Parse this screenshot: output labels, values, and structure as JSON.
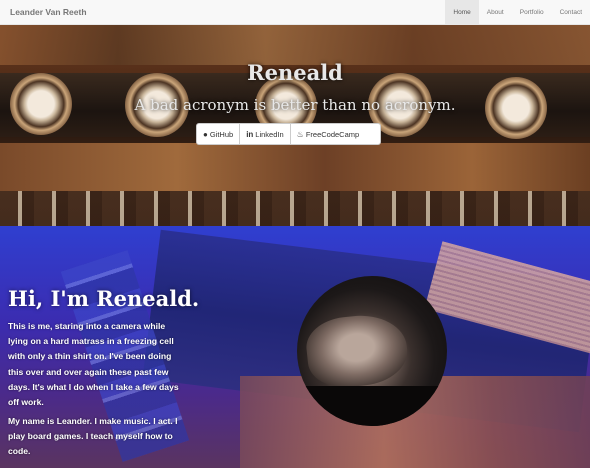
{
  "nav": {
    "brand": "Leander Van Reeth",
    "items": [
      {
        "label": "Home",
        "active": true
      },
      {
        "label": "About",
        "active": false
      },
      {
        "label": "Portfolio",
        "active": false
      },
      {
        "label": "Contact",
        "active": false
      }
    ]
  },
  "hero": {
    "title": "Reneald",
    "subtitle": "A bad acronym is better than no acronym.",
    "buttons": [
      {
        "label": "GitHub",
        "icon": "github-icon"
      },
      {
        "label": "LinkedIn",
        "icon": "linkedin-icon"
      },
      {
        "label": "FreeCodeCamp",
        "icon": "fire-icon"
      }
    ]
  },
  "about": {
    "title": "Hi, I'm Reneald.",
    "paragraph1": "This is me, staring into a camera while lying on a hard matrass in a freezing cell with only a thin shirt on. I've been doing this over and over again these past few days. It's what I do when I take a few days off work.",
    "paragraph2": "My name is Leander. I make music. I act. I play board games. I teach myself how to code."
  }
}
